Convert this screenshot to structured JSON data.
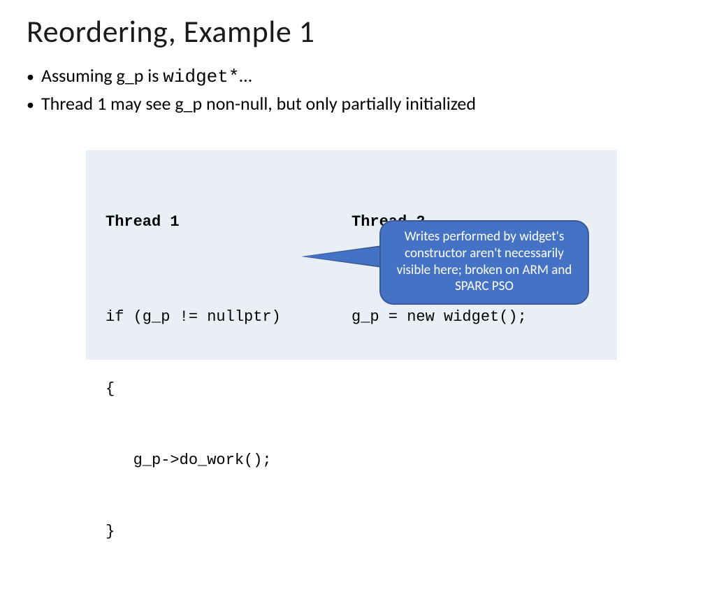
{
  "title": "Reordering, Example 1",
  "bullets": [
    {
      "prefix": "Assuming g_p is ",
      "mono": "widget*",
      "suffix": "…"
    },
    {
      "prefix": "Thread 1 may see g_p non-null, but only partially initialized",
      "mono": "",
      "suffix": ""
    }
  ],
  "code": {
    "thread1_header": "Thread 1",
    "thread2_header": "Thread 2",
    "thread1_lines": [
      "if (g_p != nullptr)",
      "{",
      "   g_p->do_work();",
      "}"
    ],
    "thread2_lines": [
      "g_p = new widget();"
    ]
  },
  "callout": {
    "text": "Writes performed by widget's constructor aren't necessarily visible here; broken on ARM and SPARC PSO"
  }
}
